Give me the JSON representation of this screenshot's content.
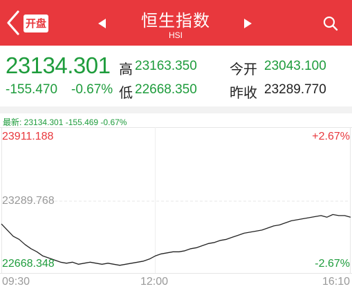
{
  "header": {
    "title": "恒生指数",
    "code": "HSI",
    "badge": "开盘",
    "icons": {
      "back": "chevron-left-icon",
      "prev": "triangle-left-icon",
      "next": "triangle-right-icon",
      "search": "search-icon"
    },
    "bg_color": "#e8383d"
  },
  "quote": {
    "price": "23134.301",
    "change": "-155.470",
    "change_pct": "-0.67%",
    "high_label": "高",
    "high": "23163.350",
    "low_label": "低",
    "low": "22668.350",
    "open_label": "今开",
    "open": "23043.100",
    "prev_close_label": "昨收",
    "prev_close": "23289.770",
    "down_color": "#1e9c3c",
    "up_color": "#e8383d"
  },
  "chart": {
    "latest_line": "最新: 23134.301  -155.469  -0.67%",
    "y_top_label": "23911.188",
    "y_mid_label": "23289.768",
    "y_bottom_label": "22668.348",
    "pct_top_label": "+2.67%",
    "pct_bottom_label": "-2.67%",
    "x_labels": [
      "09:30",
      "12:00",
      "16:10"
    ]
  },
  "chart_data": {
    "type": "line",
    "ylim": [
      22668.348,
      23911.188
    ],
    "reference": 23289.768,
    "x_labels": [
      "09:30",
      "12:00",
      "16:10"
    ],
    "series": [
      {
        "values": [
          23070,
          23010,
          22950,
          22920,
          22870,
          22830,
          22800,
          22760,
          22740,
          22720,
          22700,
          22690,
          22700,
          22680,
          22690,
          22700,
          22690,
          22680,
          22690,
          22680,
          22670,
          22680,
          22690,
          22700,
          22710,
          22730,
          22760,
          22780,
          22790,
          22800,
          22800,
          22810,
          22830,
          22840,
          22860,
          22880,
          22890,
          22910,
          22920,
          22940,
          22960,
          22980,
          22990,
          23000,
          23010,
          23030,
          23050,
          23060,
          23080,
          23100,
          23110,
          23120,
          23130,
          23140,
          23150,
          23135,
          23160,
          23150,
          23150,
          23134
        ]
      }
    ]
  }
}
